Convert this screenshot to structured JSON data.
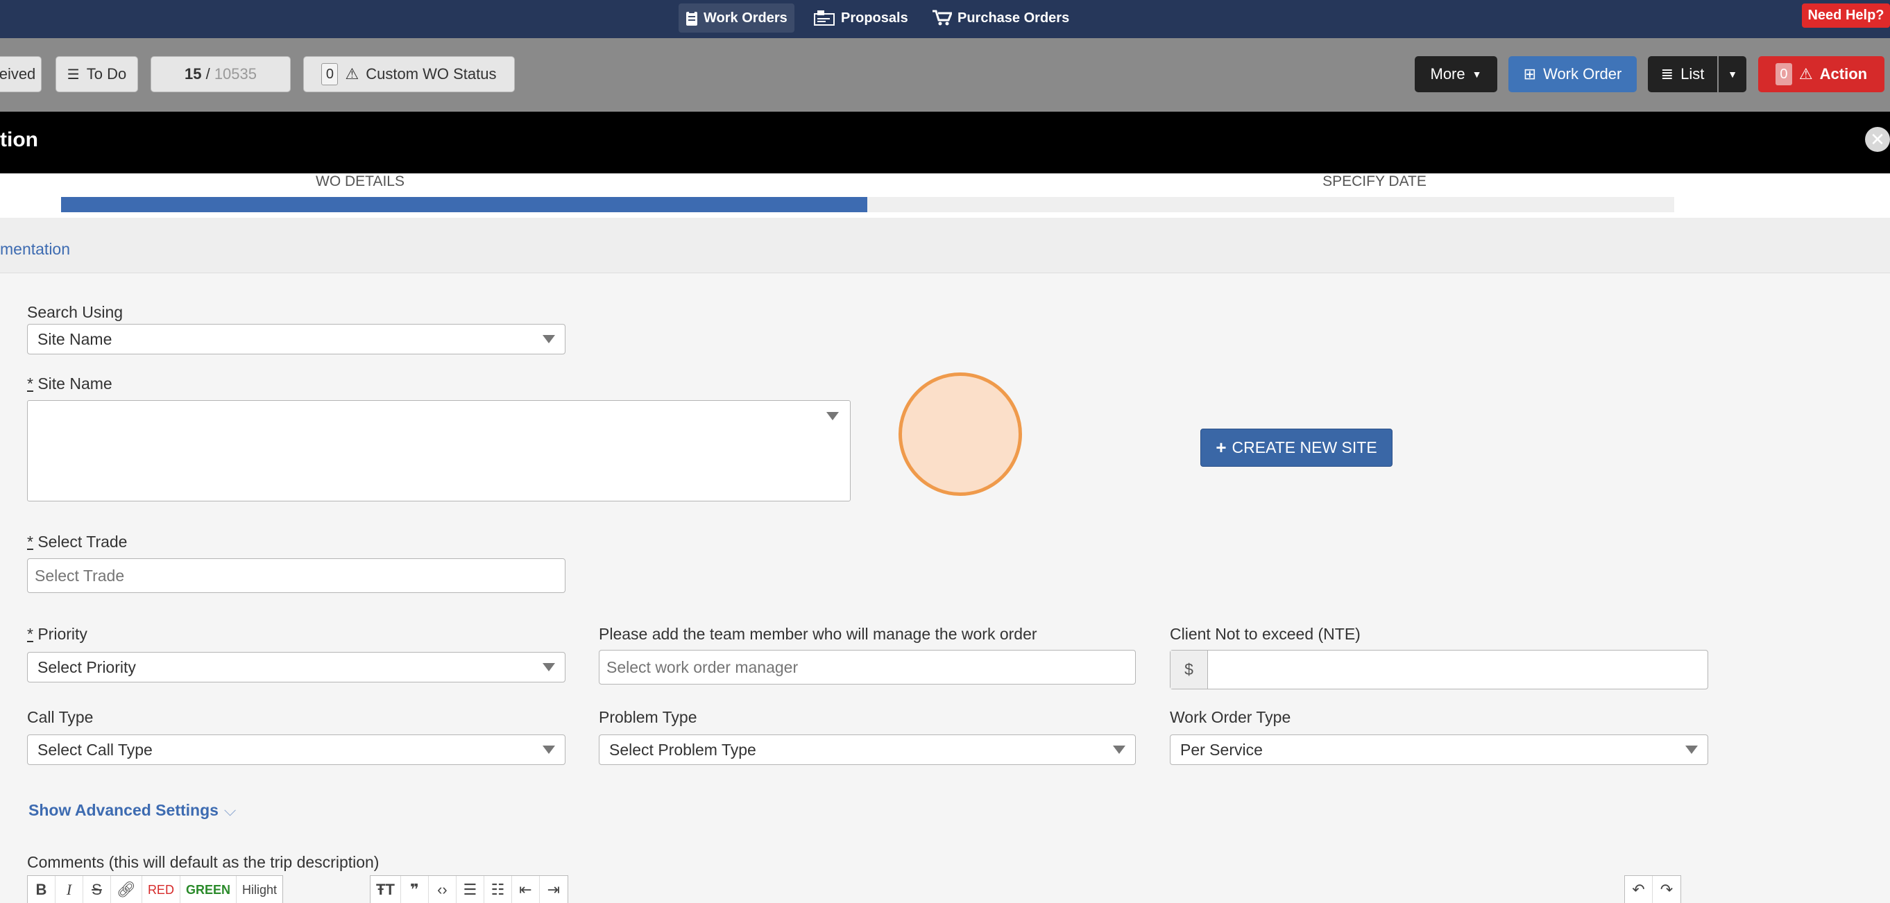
{
  "nav": {
    "work_orders": "Work Orders",
    "proposals": "Proposals",
    "purchase_orders": "Purchase Orders",
    "need_help": "Need Help?"
  },
  "toolbar": {
    "received": "eived",
    "todo": "To Do",
    "counter_current": "15",
    "counter_sep": " / ",
    "counter_total": "10535",
    "custom_status_count": "0",
    "custom_status": "Custom WO Status",
    "more": "More",
    "work_order": "Work Order",
    "list": "List",
    "action_count": "0",
    "action": "Action"
  },
  "modal": {
    "title": "tion",
    "steps": [
      "WO DETAILS",
      "SPECIFY DATE"
    ],
    "progress": 0.5,
    "subnav_link": "mentation"
  },
  "form": {
    "search_using_label": "Search Using",
    "search_using_value": "Site Name",
    "site_name_label": "Site Name",
    "create_site": "CREATE NEW SITE",
    "select_trade_label": "Select Trade",
    "select_trade_placeholder": "Select Trade",
    "priority_label": "Priority",
    "priority_value": "Select Priority",
    "manager_label": "Please add the team member who will manage the work order",
    "manager_placeholder": "Select work order manager",
    "nte_label": "Client Not to exceed (NTE)",
    "nte_prefix": "$",
    "call_type_label": "Call Type",
    "call_type_value": "Select Call Type",
    "problem_type_label": "Problem Type",
    "problem_type_value": "Select Problem Type",
    "wo_type_label": "Work Order Type",
    "wo_type_value": "Per Service",
    "advanced": "Show Advanced Settings",
    "comments_label": "Comments (this will default as the trip description)",
    "required_mark": "*"
  },
  "editor": {
    "bold": "B",
    "italic": "I",
    "red": "RED",
    "green": "GREEN",
    "hilight": "Hilight"
  },
  "colors": {
    "nav_bg": "#26375a",
    "accent_blue": "#3d6bb1",
    "danger": "#d62a2a"
  }
}
